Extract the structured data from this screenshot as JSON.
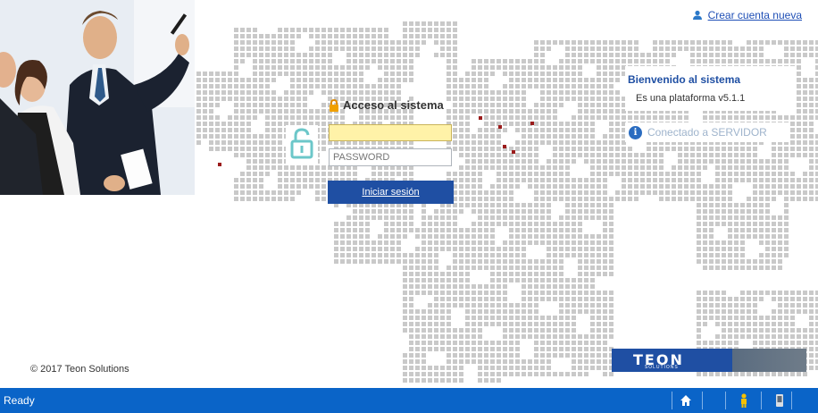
{
  "header": {
    "create_account_label": "Crear cuenta nueva"
  },
  "login": {
    "title": "Acceso al sistema",
    "username_value": "",
    "password_placeholder": "PASSWORD",
    "submit_label": "Iniciar sesión"
  },
  "welcome": {
    "title": "Bienvenido al sistema",
    "subtitle": "Es una plataforma v5.1.1",
    "status": "Conectado a SERVIDOR"
  },
  "brand": {
    "name": "TEON",
    "tagline": "SOLUTIONS"
  },
  "footer": {
    "copyright": "© 2017 Teon Solutions"
  },
  "statusbar": {
    "text": "Ready"
  },
  "colors": {
    "accent": "#1f4fa3",
    "statusbar": "#0a64c8",
    "input_highlight": "#fff2a8",
    "map_marker": "#9b1c1c"
  },
  "icons": [
    "user-add-icon",
    "lock-icon",
    "unlock-icon",
    "info-icon",
    "home-icon",
    "person-icon",
    "device-icon"
  ]
}
